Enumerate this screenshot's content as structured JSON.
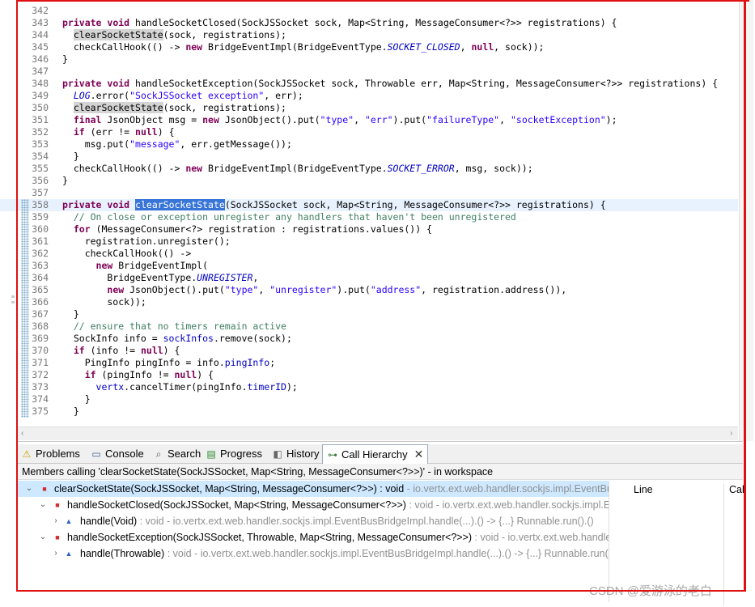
{
  "editor": {
    "lines": [
      {
        "n": "342",
        "html": ""
      },
      {
        "n": "343",
        "html": "<span class=\"kw\">private</span> <span class=\"kw\">void</span> handleSocketClosed(SockJSSocket sock, Map&lt;String, MessageConsumer&lt;?&gt;&gt; registrations) {"
      },
      {
        "n": "344",
        "html": "  <span class=\"occ\">clearSocketState</span>(sock, registrations);"
      },
      {
        "n": "345",
        "html": "  checkCallHook(() -&gt; <span class=\"kw\">new</span> BridgeEventImpl(BridgeEventType.<span class=\"stf\">SOCKET_CLOSED</span>, <span class=\"kw\">null</span>, sock));"
      },
      {
        "n": "346",
        "html": "}"
      },
      {
        "n": "347",
        "html": ""
      },
      {
        "n": "348",
        "html": "<span class=\"kw\">private</span> <span class=\"kw\">void</span> handleSocketException(SockJSSocket sock, Throwable err, Map&lt;String, MessageConsumer&lt;?&gt;&gt; registrations) {"
      },
      {
        "n": "349",
        "html": "  <span class=\"stf\">LOG</span>.error(<span class=\"str\">\"SockJSSocket exception\"</span>, err);"
      },
      {
        "n": "350",
        "html": "  <span class=\"occ\">clearSocketState</span>(sock, registrations);"
      },
      {
        "n": "351",
        "html": "  <span class=\"kw\">final</span> JsonObject msg = <span class=\"kw\">new</span> JsonObject().put(<span class=\"str\">\"type\"</span>, <span class=\"str\">\"err\"</span>).put(<span class=\"str\">\"failureType\"</span>, <span class=\"str\">\"socketException\"</span>);"
      },
      {
        "n": "352",
        "html": "  <span class=\"kw\">if</span> (err != <span class=\"kw\">null</span>) {"
      },
      {
        "n": "353",
        "html": "    msg.put(<span class=\"str\">\"message\"</span>, err.getMessage());"
      },
      {
        "n": "354",
        "html": "  }"
      },
      {
        "n": "355",
        "html": "  checkCallHook(() -&gt; <span class=\"kw\">new</span> BridgeEventImpl(BridgeEventType.<span class=\"stf\">SOCKET_ERROR</span>, msg, sock));"
      },
      {
        "n": "356",
        "html": "}"
      },
      {
        "n": "357",
        "html": ""
      },
      {
        "n": "358",
        "html": "<span class=\"kw\">private</span> <span class=\"kw\">void</span> <span class=\"sel\">clearSocketState</span>(SockJSSocket sock, Map&lt;String, MessageConsumer&lt;?&gt;&gt; registrations) {"
      },
      {
        "n": "359",
        "html": "  <span class=\"cm\">// On close or exception unregister any handlers that haven't been unregistered</span>"
      },
      {
        "n": "360",
        "html": "  <span class=\"kw\">for</span> (MessageConsumer&lt;?&gt; registration : registrations.values()) {"
      },
      {
        "n": "361",
        "html": "    registration.unregister();"
      },
      {
        "n": "362",
        "html": "    checkCallHook(() -&gt;"
      },
      {
        "n": "363",
        "html": "      <span class=\"kw\">new</span> BridgeEventImpl("
      },
      {
        "n": "364",
        "html": "        BridgeEventType.<span class=\"stf\">UNREGISTER</span>,"
      },
      {
        "n": "365",
        "html": "        <span class=\"kw\">new</span> JsonObject().put(<span class=\"str\">\"type\"</span>, <span class=\"str\">\"unregister\"</span>).put(<span class=\"str\">\"address\"</span>, registration.address()),"
      },
      {
        "n": "366",
        "html": "        sock));"
      },
      {
        "n": "367",
        "html": "  }"
      },
      {
        "n": "368",
        "html": "  <span class=\"cm\">// ensure that no timers remain active</span>"
      },
      {
        "n": "369",
        "html": "  SockInfo info = <span class=\"fld\">sockInfos</span>.remove(sock);"
      },
      {
        "n": "370",
        "html": "  <span class=\"kw\">if</span> (info != <span class=\"kw\">null</span>) {"
      },
      {
        "n": "371",
        "html": "    PingInfo pingInfo = info.<span class=\"fld\">pingInfo</span>;"
      },
      {
        "n": "372",
        "html": "    <span class=\"kw\">if</span> (pingInfo != <span class=\"kw\">null</span>) {"
      },
      {
        "n": "373",
        "html": "      <span class=\"fld\">vertx</span>.cancelTimer(pingInfo.<span class=\"fld\">timerID</span>);"
      },
      {
        "n": "374",
        "html": "    }"
      },
      {
        "n": "375",
        "html": "  }"
      }
    ]
  },
  "tabs": [
    {
      "label": "Problems",
      "icon": "problems-icon",
      "glyph": "⚠"
    },
    {
      "label": "Console",
      "icon": "console-icon",
      "glyph": "▭"
    },
    {
      "label": "Search",
      "icon": "search-icon",
      "glyph": "⌕"
    },
    {
      "label": "Progress",
      "icon": "progress-icon",
      "glyph": "▤"
    },
    {
      "label": "History",
      "icon": "history-icon",
      "glyph": "◧"
    },
    {
      "label": "Call Hierarchy",
      "icon": "call-hierarchy-icon",
      "glyph": "⊶"
    }
  ],
  "call_hierarchy": {
    "header": "Members calling 'clearSocketState(SockJSSocket, Map<String, MessageConsumer<?>>)' - in workspace",
    "rows": [
      {
        "text": "clearSocketState(SockJSSocket, Map<String, MessageConsumer<?>>) : void",
        "detail": " - io.vertx.ext.web.handler.sockjs.impl.EventBusBridgeImpl"
      },
      {
        "text": "handleSocketClosed(SockJSSocket, Map<String, MessageConsumer<?>>)",
        "detail": " : void - io.vertx.ext.web.handler.sockjs.impl.EventBusBridgeImpl"
      },
      {
        "text": "handle(Void)",
        "detail": " : void - io.vertx.ext.web.handler.sockjs.impl.EventBusBridgeImpl.handle(...).() -> {...} Runnable.run().()"
      },
      {
        "text": "handleSocketException(SockJSSocket, Throwable, Map<String, MessageConsumer<?>>)",
        "detail": " : void - io.vertx.ext.web.handler.sockjs.impl.EventBusBridgeImpl"
      },
      {
        "text": "handle(Throwable)",
        "detail": " : void - io.vertx.ext.web.handler.sockjs.impl.EventBusBridgeImpl.handle(...).() -> {...} Runnable.run().()"
      }
    ],
    "col_line": "Line",
    "col_call": "Call"
  },
  "watermark": "CSDN @爱游泳的老白"
}
